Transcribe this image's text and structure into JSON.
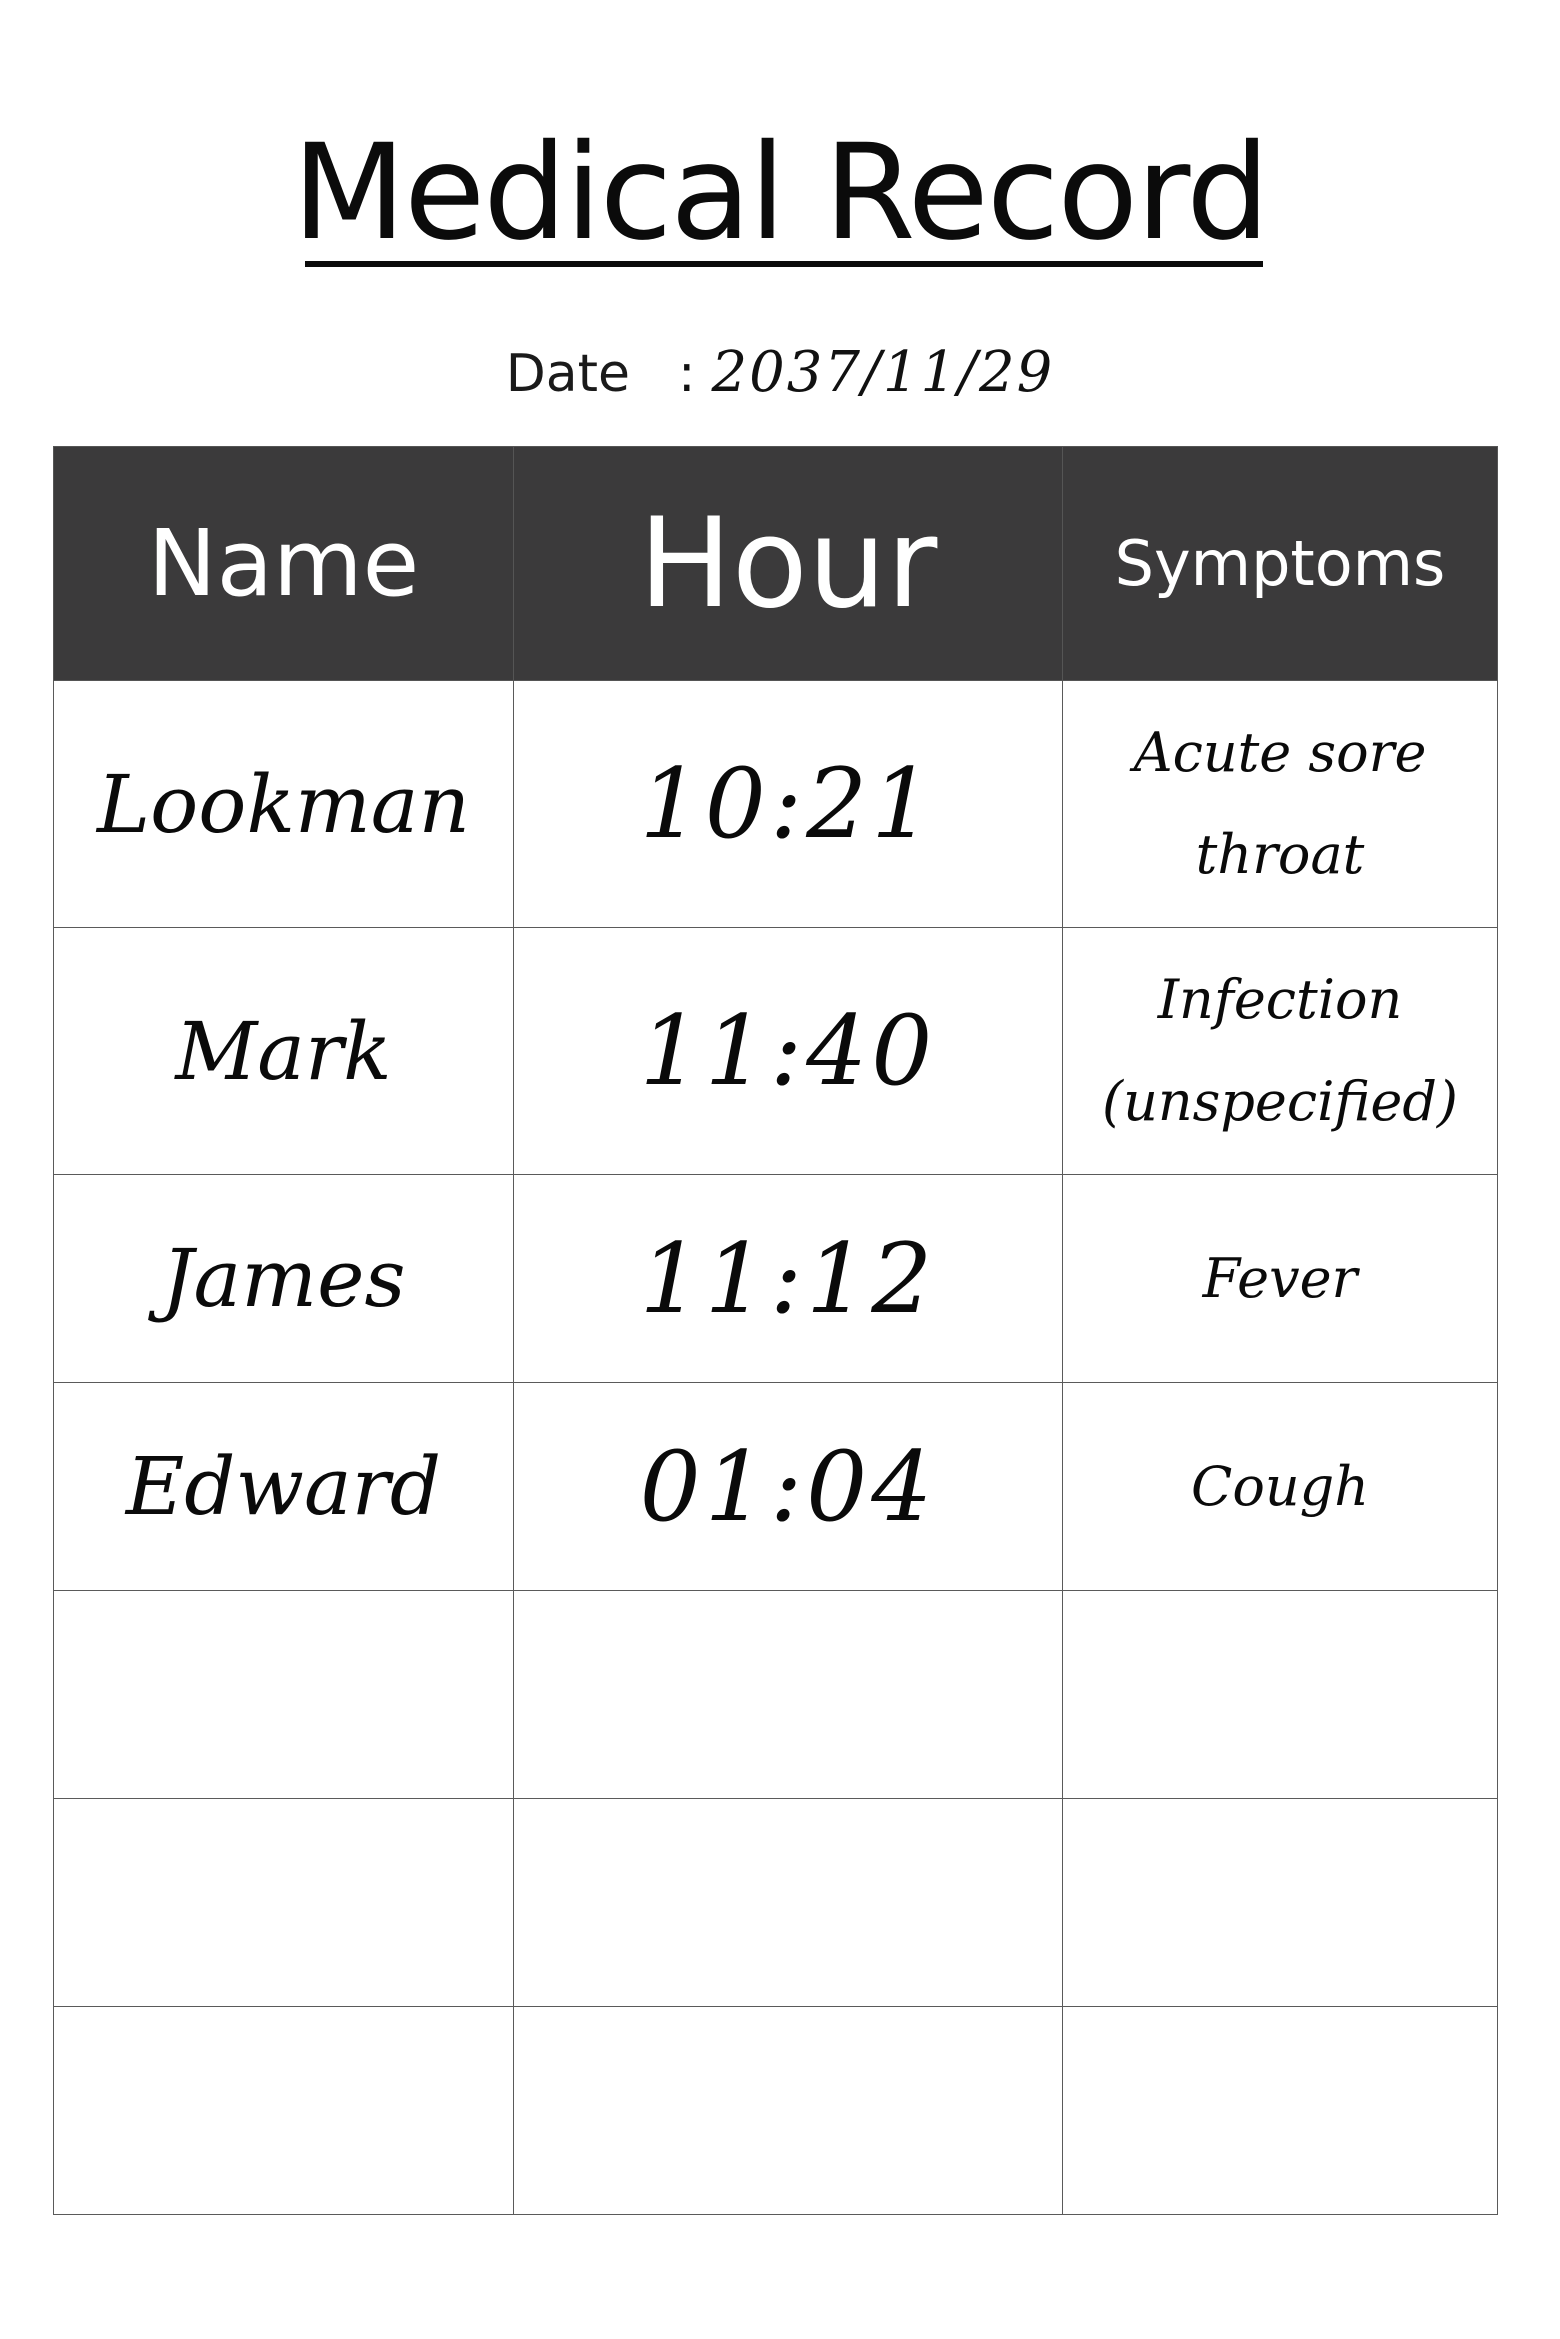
{
  "document": {
    "title": "Medical Record",
    "date_label": "Date",
    "date_separator": ":",
    "date_value": "2037/11/29"
  },
  "table": {
    "headers": {
      "name": "Name",
      "hour": "Hour",
      "symptoms": "Symptoms"
    },
    "rows": [
      {
        "name": "Lookman",
        "hour": "10:21",
        "symptoms": "Acute sore throat"
      },
      {
        "name": "Mark",
        "hour": "11:40",
        "symptoms": "Infection (unspecified)"
      },
      {
        "name": "James",
        "hour": "11:12",
        "symptoms": "Fever"
      },
      {
        "name": "Edward",
        "hour": "01:04",
        "symptoms": "Cough"
      },
      {
        "name": "",
        "hour": "",
        "symptoms": ""
      },
      {
        "name": "",
        "hour": "",
        "symptoms": ""
      },
      {
        "name": "",
        "hour": "",
        "symptoms": ""
      }
    ]
  },
  "colors": {
    "header_background": "#3b3a3b",
    "header_text": "#ffffff",
    "grid_line": "#5a5a5a",
    "text": "#0a0a0a"
  }
}
